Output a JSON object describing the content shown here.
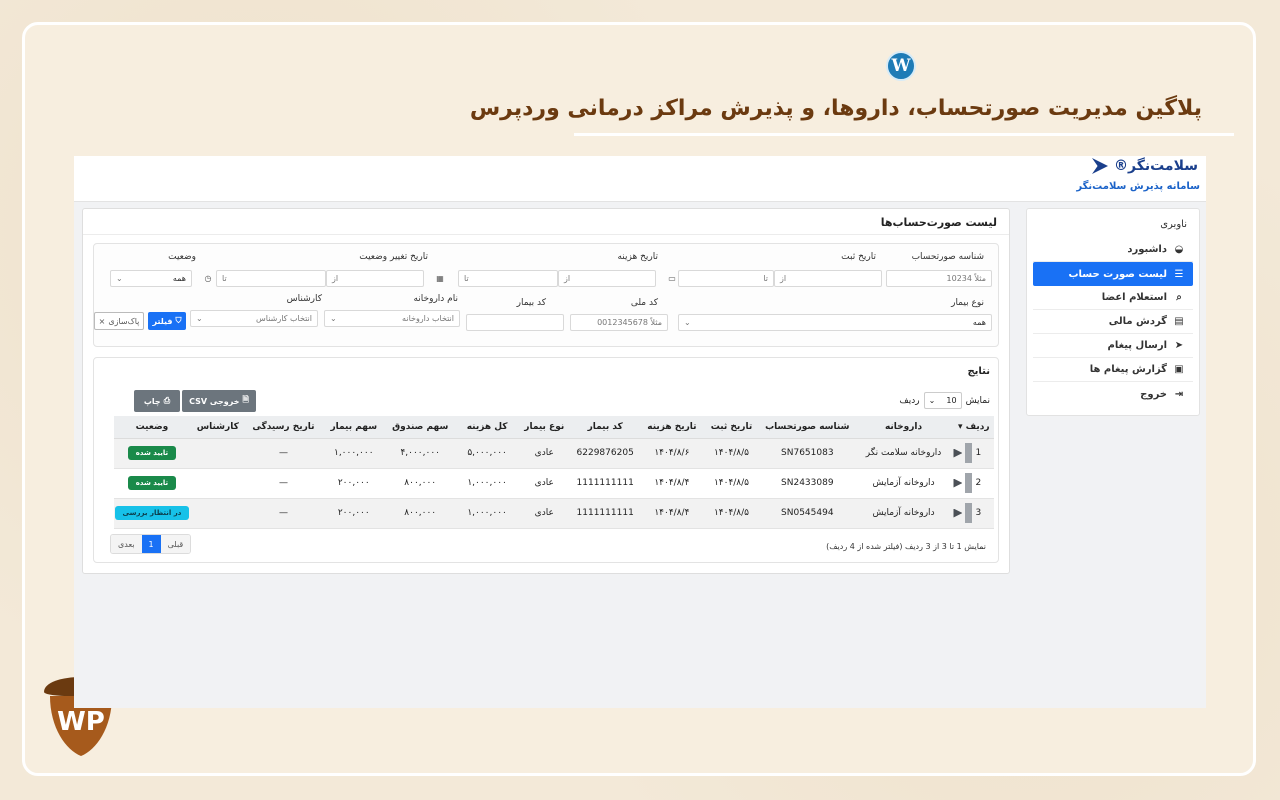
{
  "headline": "پلاگین مدیریت صورتحساب، داروها، و پذیرش مراکز درمانی وردپرس",
  "brand": {
    "logo_text": "سلامت‌نگر®",
    "subtitle": "سامانه پذیرش سلامت‌نگر",
    "watermark": "WP"
  },
  "sidebar": {
    "title": "ناوبری",
    "items": [
      {
        "label": "داشبورد",
        "icon": "dashboard-icon"
      },
      {
        "label": "لیست صورت حساب",
        "icon": "list-icon"
      },
      {
        "label": "استعلام اعضا",
        "icon": "search-icon"
      },
      {
        "label": "گردش مالی",
        "icon": "document-icon"
      },
      {
        "label": "ارسال پیغام",
        "icon": "send-icon"
      },
      {
        "label": "گزارش پیغام ها",
        "icon": "report-icon"
      },
      {
        "label": "خروج",
        "icon": "logout-icon"
      }
    ]
  },
  "main": {
    "title": "لیست صورت‌حساب‌ها"
  },
  "filters": {
    "invoice_id_label": "شناسه صورتحساب",
    "invoice_id_placeholder": "مثلاً 10234",
    "reg_date_label": "تاریخ ثبت",
    "cost_date_label": "تاریخ هزینه",
    "status_change_label": "تاریخ تغییر وضعیت",
    "status_label": "وضعیت",
    "from": "از",
    "to": "تا",
    "status_value": "همه",
    "patient_type_label": "نوع بیمار",
    "patient_type_value": "همه",
    "national_code_label": "کد ملی",
    "national_code_placeholder": "مثلاً 0012345678",
    "patient_code_label": "کد بیمار",
    "pharmacy_label": "نام داروخانه",
    "pharmacy_placeholder": "انتخاب داروخانه",
    "expert_label": "کارشناس",
    "expert_placeholder": "انتخاب کارشناس",
    "filter_button": "فیلتر",
    "clear_button": "پاک‌سازی"
  },
  "results": {
    "title": "نتایج",
    "show_label": "نمایش",
    "rows_label": "ردیف",
    "page_length": "10",
    "csv_button": "خروجی CSV",
    "print_button": "چاپ",
    "columns": [
      "ردیف",
      "داروخانه",
      "شناسه صورتحساب",
      "تاریخ ثبت",
      "تاریخ هزینه",
      "کد بیمار",
      "نوع بیمار",
      "کل هزینه",
      "سهم صندوق",
      "سهم بیمار",
      "تاریخ رسیدگی",
      "کارشناس",
      "وضعیت"
    ],
    "rows": [
      {
        "num": "1",
        "pharmacy": "داروخانه سلامت نگر",
        "invoice": "SN7651083",
        "reg_date": "۱۴۰۴/۸/۵",
        "cost_date": "۱۴۰۴/۸/۶",
        "patient_code": "6229876205",
        "patient_type": "عادی",
        "total": "۵,۰۰۰,۰۰۰",
        "fund": "۴,۰۰۰,۰۰۰",
        "patient_share": "۱,۰۰۰,۰۰۰",
        "review_date": "—",
        "expert": "",
        "status": "تایید شده"
      },
      {
        "num": "2",
        "pharmacy": "داروخانه آزمایش",
        "invoice": "SN2433089",
        "reg_date": "۱۴۰۴/۸/۵",
        "cost_date": "۱۴۰۴/۸/۴",
        "patient_code": "1111111111",
        "patient_type": "عادی",
        "total": "۱,۰۰۰,۰۰۰",
        "fund": "۸۰۰,۰۰۰",
        "patient_share": "۲۰۰,۰۰۰",
        "review_date": "—",
        "expert": "",
        "status": "تایید شده"
      },
      {
        "num": "3",
        "pharmacy": "داروخانه آزمایش",
        "invoice": "SN0545494",
        "reg_date": "۱۴۰۴/۸/۵",
        "cost_date": "۱۴۰۴/۸/۴",
        "patient_code": "1111111111",
        "patient_type": "عادی",
        "total": "۱,۰۰۰,۰۰۰",
        "fund": "۸۰۰,۰۰۰",
        "patient_share": "۲۰۰,۰۰۰",
        "review_date": "—",
        "expert": "",
        "status": "در انتظار بررسی"
      }
    ],
    "info": "نمایش 1 تا 3 از 3 ردیف (فیلتر شده از 4 ردیف)",
    "pager": {
      "prev": "قبلی",
      "current": "1",
      "next": "بعدی"
    }
  },
  "colors": {
    "accent": "#1971f5",
    "headline": "#6b3a10",
    "success": "#1a8a4a",
    "pending": "#17c1e8"
  }
}
